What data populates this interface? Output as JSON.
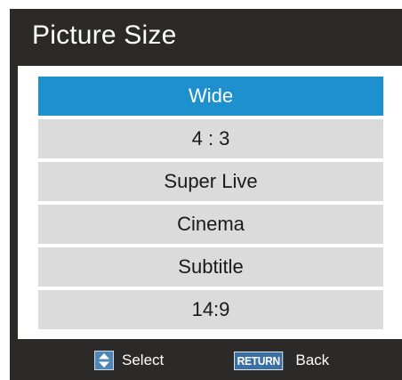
{
  "window": {
    "title": "Picture Size"
  },
  "menu": {
    "selected_index": 0,
    "items": [
      {
        "label": "Wide"
      },
      {
        "label": "4 : 3"
      },
      {
        "label": "Super Live"
      },
      {
        "label": "Cinema"
      },
      {
        "label": "Subtitle"
      },
      {
        "label": "14:9"
      }
    ]
  },
  "footer": {
    "select_icon": "up-down-arrows-icon",
    "select_label": "Select",
    "return_key_label": "RETURN",
    "back_label": "Back"
  },
  "colors": {
    "background": "#2b2a29",
    "selected_item": "#1f90ce",
    "item": "#dcdbdb",
    "panel": "#ffffff",
    "title_text": "#ffffff"
  }
}
